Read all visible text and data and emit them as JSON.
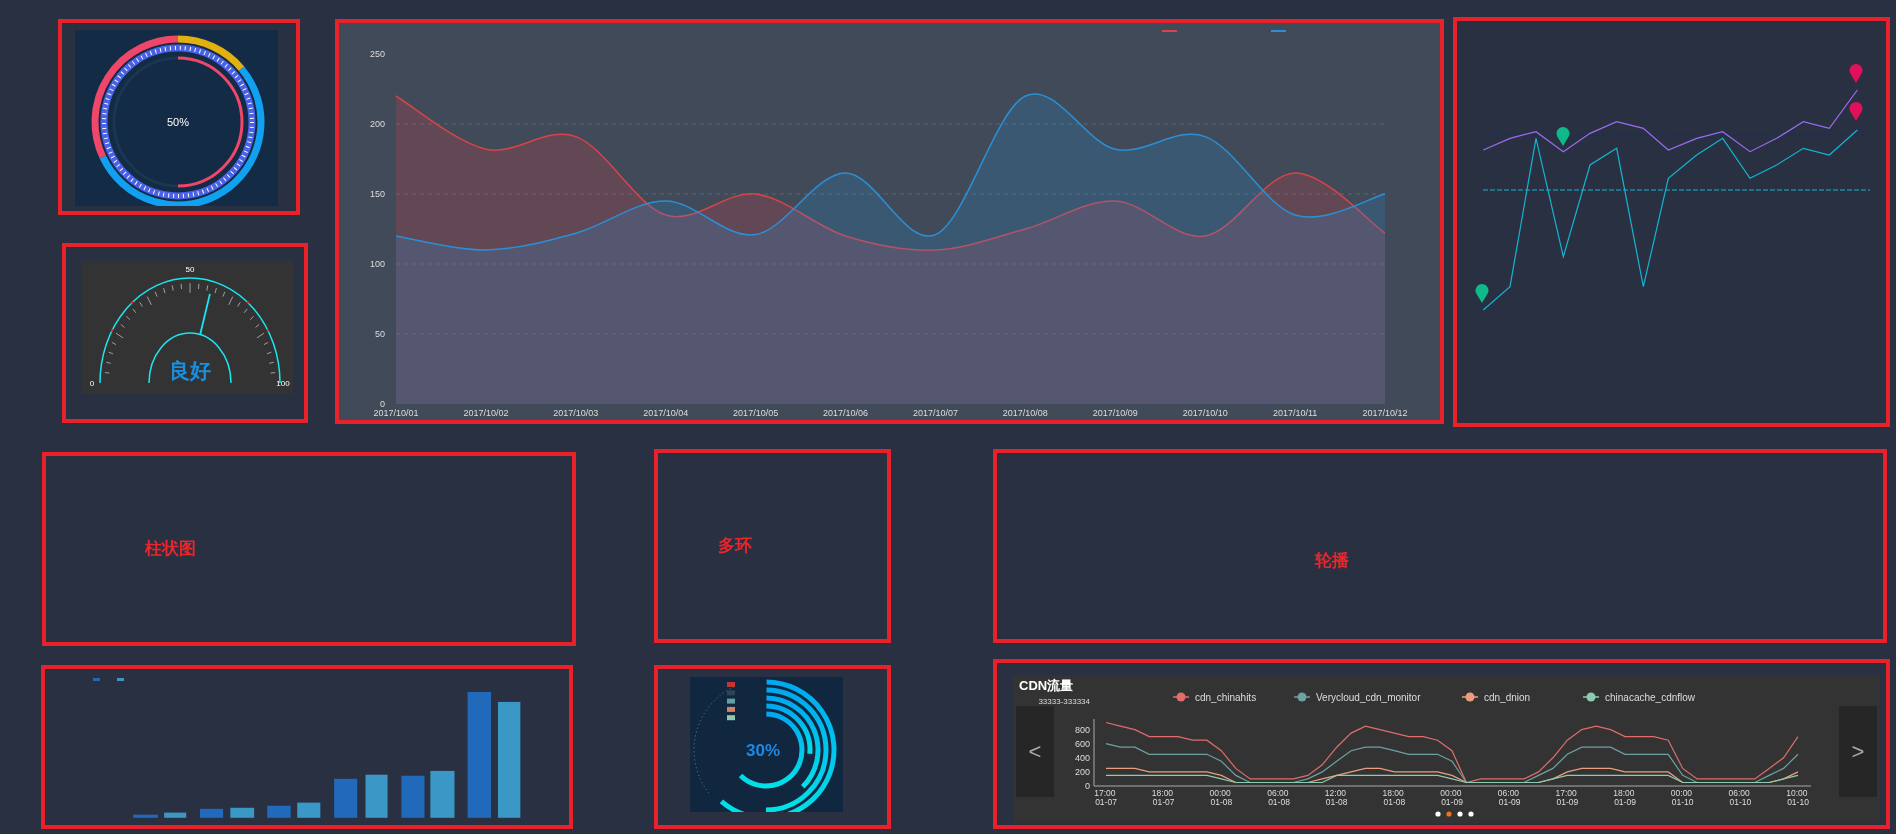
{
  "ring_gauge": {
    "label": "50%",
    "level": 0.5
  },
  "speedometer": {
    "scale_labels": [
      "0",
      "50",
      "100"
    ],
    "status": "良好",
    "level": 0.58
  },
  "area_chart": {
    "chart_data": {
      "type": "area",
      "categories": [
        "2017/10/01",
        "2017/10/02",
        "2017/10/03",
        "2017/10/04",
        "2017/10/05",
        "2017/10/06",
        "2017/10/07",
        "2017/10/08",
        "2017/10/09",
        "2017/10/10",
        "2017/10/11",
        "2017/10/12"
      ],
      "series": [
        {
          "color": "#d9434a",
          "values": [
            220,
            182,
            191,
            135,
            150,
            120,
            110,
            125,
            145,
            120,
            165,
            122
          ]
        },
        {
          "color": "#2b8fd6",
          "values": [
            120,
            110,
            122,
            145,
            121,
            165,
            121,
            220,
            182,
            191,
            135,
            150
          ]
        }
      ],
      "ylim": [
        0,
        250
      ],
      "yticks": [
        0,
        50,
        100,
        150,
        200,
        250
      ],
      "grid": true
    }
  },
  "line_chart": {
    "series": [
      {
        "color": "#9b6cf0"
      },
      {
        "color": "#12b5d4"
      }
    ]
  },
  "placeholders": [
    {
      "label": "柱状图"
    },
    {
      "label": "多环"
    },
    {
      "label": "轮播"
    }
  ],
  "bar_chart": {
    "legend": [
      {
        "color": "#2169bb"
      },
      {
        "color": "#3b98c6"
      }
    ]
  },
  "multi_ring": {
    "label": "30%",
    "legend": [
      {
        "color": "#c23531"
      },
      {
        "color": "#2f4554"
      },
      {
        "color": "#61a0a8"
      },
      {
        "color": "#d48265"
      },
      {
        "color": "#91c7ae"
      }
    ]
  },
  "cdn": {
    "title": "CDN流量",
    "chart_data": {
      "type": "line",
      "categories": [
        "17:00 01-07",
        null,
        null,
        null,
        "18:00 01-07",
        null,
        null,
        null,
        "00:00 01-08",
        null,
        null,
        null,
        "06:00 01-08",
        null,
        null,
        null,
        "12:00 01-08",
        null,
        null,
        null,
        "18:00 01-08",
        null,
        null,
        null,
        "00:00 01-09",
        null,
        null,
        null,
        "06:00 01-09",
        null,
        null,
        null,
        "17:00 01-09",
        null,
        null,
        null,
        "18:00 01-09",
        null,
        null,
        null,
        "00:00 01-10",
        null,
        null,
        null,
        "06:00 01-10",
        null,
        null,
        null,
        "10:00 01-10"
      ],
      "ylim": [
        0,
        950
      ],
      "yticks": [
        0,
        200,
        400,
        600,
        800
      ],
      "legend": "top",
      "series": [
        {
          "name": "cdn_chinahits",
          "color": "#e06c6c",
          "values": [
            900,
            850,
            800,
            700,
            700,
            700,
            650,
            650,
            500,
            250,
            100,
            100,
            100,
            100,
            150,
            300,
            550,
            750,
            850,
            800,
            750,
            700,
            700,
            650,
            500,
            50,
            100,
            100,
            100,
            100,
            200,
            400,
            650,
            800,
            850,
            800,
            700,
            700,
            700,
            650,
            250,
            100,
            100,
            100,
            100,
            100,
            250,
            400,
            700
          ]
        },
        {
          "name": "Verycloud_cdn_monitor",
          "color": "#6fa0a3",
          "values": [
            600,
            550,
            550,
            450,
            450,
            450,
            450,
            450,
            350,
            150,
            50,
            50,
            50,
            50,
            100,
            200,
            350,
            500,
            550,
            550,
            500,
            450,
            450,
            450,
            350,
            50,
            50,
            50,
            50,
            50,
            150,
            250,
            450,
            550,
            550,
            550,
            450,
            450,
            450,
            450,
            150,
            50,
            50,
            50,
            50,
            50,
            150,
            250,
            450
          ]
        },
        {
          "name": "cdn_dnion",
          "color": "#eb9e7e",
          "values": [
            250,
            250,
            250,
            200,
            200,
            200,
            200,
            200,
            150,
            50,
            50,
            50,
            50,
            50,
            50,
            100,
            150,
            200,
            250,
            250,
            200,
            200,
            200,
            200,
            150,
            50,
            50,
            50,
            50,
            50,
            50,
            100,
            200,
            250,
            250,
            250,
            200,
            200,
            200,
            200,
            50,
            50,
            50,
            50,
            50,
            50,
            50,
            100,
            200
          ]
        },
        {
          "name": "chinacache_cdnflow",
          "color": "#8ccbb0",
          "values": [
            150,
            150,
            150,
            150,
            150,
            150,
            150,
            150,
            100,
            50,
            50,
            50,
            50,
            50,
            50,
            50,
            150,
            150,
            150,
            150,
            150,
            150,
            150,
            150,
            100,
            50,
            50,
            50,
            50,
            50,
            50,
            100,
            150,
            150,
            150,
            150,
            150,
            150,
            150,
            150,
            50,
            50,
            50,
            50,
            50,
            50,
            50,
            100,
            150
          ]
        }
      ]
    },
    "axis_caption": "33333-333334",
    "prev_button": "<",
    "next_button": ">",
    "dots": [
      {
        "selected": false
      },
      {
        "selected": true
      },
      {
        "selected": false
      },
      {
        "selected": false
      }
    ]
  }
}
